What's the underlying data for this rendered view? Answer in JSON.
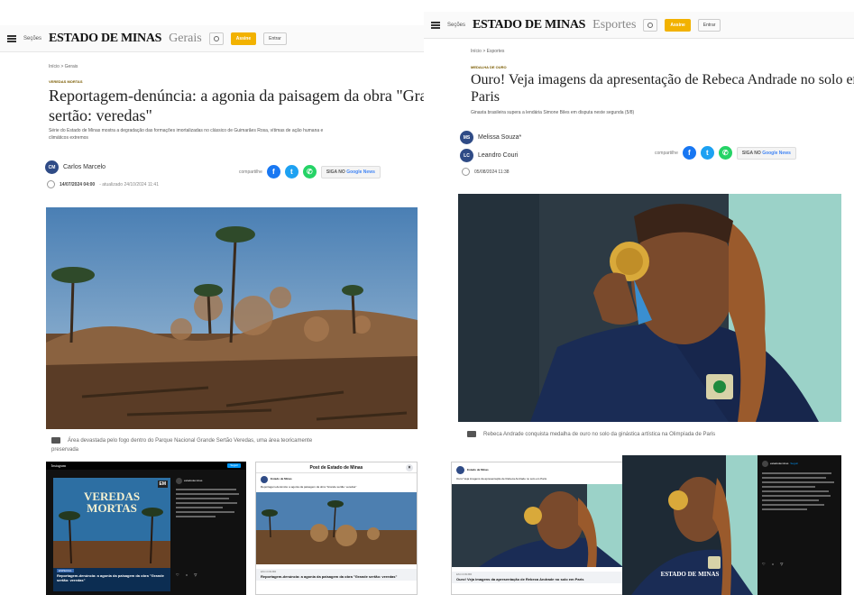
{
  "left": {
    "menu_label": "Seções",
    "brand": "ESTADO DE MINAS",
    "section": "Gerais",
    "assine": "Assine",
    "entrar": "Entrar",
    "breadcrumb": "Início  >  Gerais",
    "kicker": "VEREDAS MORTAS",
    "headline_line1": "Reportagem-denúncia: a agonia da paisagem da obra \"Grand",
    "headline_line2": "sertão: veredas\"",
    "subtitle_line1": "Série do Estado de Minas mostra a degradação das formações imortalizadas no clássico de Guimarães Rosa, vítimas de ação humana e",
    "subtitle_line2": "climáticos extremos",
    "author_initials": "CM",
    "author": "Carlos Marcelo",
    "date": "14/07/2024 04:00",
    "updated": "- atualizado 24/10/2024 11:41",
    "share_label": "compartilhe",
    "google_news_prefix": "SIGA NO",
    "google_news_brand": "Google News",
    "caption_line1": "Área devastada pelo fogo dentro do Parque Nacional Grande Sertão Veredas, uma área teoricamente",
    "caption_line2": "preservada",
    "insta_brand": "Instagram",
    "insta_follow": "Seguir",
    "insta_cover_title1": "VEREDAS",
    "insta_cover_title2": "MORTAS",
    "insta_cover_badge": "EM",
    "insta_cover_tag": "ESPECIAL",
    "insta_cover_headline": "Reportagem-denúncia: a agonia da paisagem da obra \"Grande sertão: veredas\"",
    "insta_account": "estadodeminas",
    "fb_post_title": "Post de Estado de Minas",
    "fb_page_name": "Estado de Minas",
    "fb_post_text": "Reportagem-denúncia: a agonia da paisagem da obra \"Grande sertão: veredas\"",
    "fb_link_title": "Reportagem-denúncia: a agonia da paisagem da obra \"Grande sertão: veredas\"",
    "fb_link_domain": "EM.COM.BR"
  },
  "right": {
    "menu_label": "Seções",
    "brand": "ESTADO DE MINAS",
    "section": "Esportes",
    "assine": "Assine",
    "entrar": "Entrar",
    "breadcrumb": "Início  >  Esportes",
    "kicker": "MEDALHA DE OURO",
    "headline_line1": "Ouro! Veja imagens da apresentação de Rebeca Andrade no solo em",
    "headline_line2": "Paris",
    "subtitle": "Ginasta brasileira supera a lendária Simone Biles em disputa neste segunda (5/8)",
    "author1_initials": "MS",
    "author1": "Melissa Souza*",
    "author2_initials": "LC",
    "author2": "Leandro Couri",
    "date": "05/08/2024 11:38",
    "share_label": "compartilhe",
    "google_news_prefix": "SIGA NO",
    "google_news_brand": "Google News",
    "caption": "Rebeca Andrade conquista medalha de ouro no solo da ginástica artística na Olimpíada de Paris",
    "fb_page_name": "Estado de Minas",
    "fb_post_text": "Ouro! Veja imagens da apresentação de Rebeca Andrade no solo em Paris",
    "fb_link_domain": "EM.COM.BR",
    "fb_link_title": "Ouro! Veja imagens da apresentação de Rebeca Andrade no solo em Paris",
    "insta_account": "estadodeminas",
    "insta_watermark": "ESTADO DE MINAS",
    "insta_follow": "Seguir"
  }
}
